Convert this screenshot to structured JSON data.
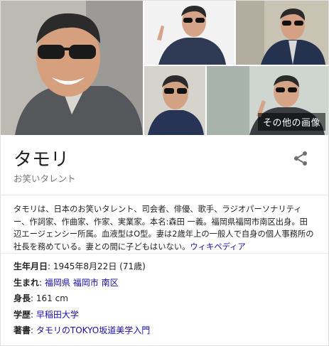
{
  "images": {
    "more_label": "その他の画像"
  },
  "entity": {
    "title": "タモリ",
    "subtitle": "お笑いタレント",
    "description": "タモリは、日本のお笑いタレント、司会者、俳優、歌手、ラジオパーソナリティー、作詞家、作曲家、作家、実業家。本名:森田 一義。福岡県福岡市南区出身。田辺エージェンシー所属。血液型はO型。妻は2歳年上の一般人で自身の個人事務所の社長を務めている。妻との間に子どもはいない。",
    "source_link": "ウィキペディア"
  },
  "facts": [
    {
      "key": "生年月日",
      "sep": ": ",
      "value": "1945年8月22日 (71歳)",
      "links": []
    },
    {
      "key": "生まれ",
      "sep": ": ",
      "value": "",
      "links": [
        "福岡県",
        "福岡市",
        "南区"
      ]
    },
    {
      "key": "身長",
      "sep": ": ",
      "value": "161 cm",
      "links": []
    },
    {
      "key": "学歴",
      "sep": ": ",
      "value": "",
      "links": [
        "早稲田大学"
      ]
    },
    {
      "key": "著書",
      "sep": ": ",
      "value": "",
      "links": [
        "タモリのTOKYO坂道美学入門"
      ]
    }
  ],
  "colors": {
    "link": "#1a0dab",
    "text": "#222222",
    "muted": "#777777",
    "share_icon": "#6f6f6f"
  },
  "icons": {
    "share": "share-icon"
  }
}
